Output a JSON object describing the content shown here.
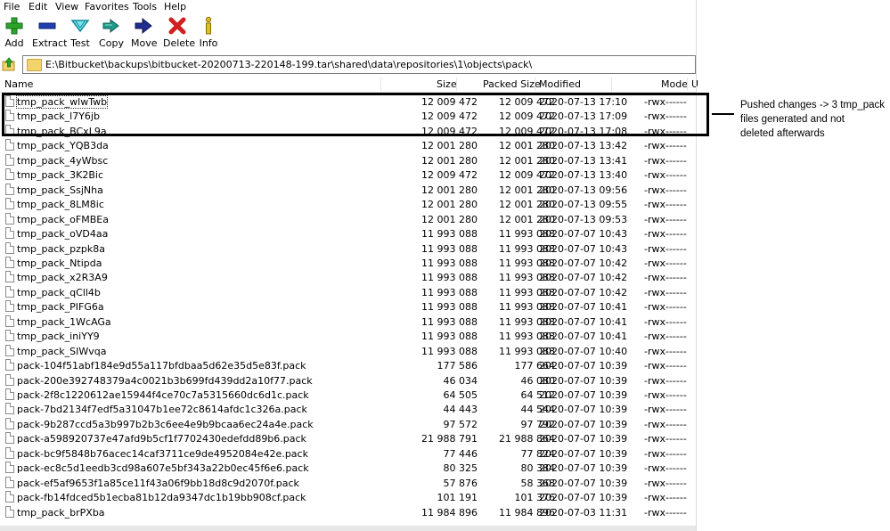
{
  "menu": [
    "File",
    "Edit",
    "View",
    "Favorites",
    "Tools",
    "Help"
  ],
  "toolbar": [
    {
      "label": "Add",
      "icon": "plus-icon",
      "color": "#2aa52a"
    },
    {
      "label": "Extract",
      "icon": "minus-icon",
      "color": "#1f3fb0"
    },
    {
      "label": "Test",
      "icon": "check-icon",
      "color": "#20b8c8"
    },
    {
      "label": "Copy",
      "icon": "double-arrow-icon",
      "color": "#1f9a8a"
    },
    {
      "label": "Move",
      "icon": "arrow-right-icon",
      "color": "#1f2f90"
    },
    {
      "label": "Delete",
      "icon": "cross-icon",
      "color": "#d02020"
    },
    {
      "label": "Info",
      "icon": "info-icon",
      "color": "#e0c020"
    }
  ],
  "address": {
    "path": "E:\\Bitbucket\\backups\\bitbucket-20200713-220148-199.tar\\shared\\data\\repositories\\1\\objects\\pack\\"
  },
  "columns": {
    "name": "Name",
    "size": "Size",
    "packed": "Packed Size",
    "modified": "Modified",
    "mode": "Mode",
    "user": "U"
  },
  "files": [
    {
      "name": "tmp_pack_wlwTwb",
      "size": "12 009 472",
      "packed": "12 009 472",
      "modified": "2020-07-13 17:10",
      "mode": "-rwx------"
    },
    {
      "name": "tmp_pack_l7Y6jb",
      "size": "12 009 472",
      "packed": "12 009 472",
      "modified": "2020-07-13 17:09",
      "mode": "-rwx------"
    },
    {
      "name": "tmp_pack_BCxL9a",
      "size": "12 009 472",
      "packed": "12 009 472",
      "modified": "2020-07-13 17:08",
      "mode": "-rwx------"
    },
    {
      "name": "tmp_pack_YQB3da",
      "size": "12 001 280",
      "packed": "12 001 280",
      "modified": "2020-07-13 13:42",
      "mode": "-rwx------"
    },
    {
      "name": "tmp_pack_4yWbsc",
      "size": "12 001 280",
      "packed": "12 001 280",
      "modified": "2020-07-13 13:41",
      "mode": "-rwx------"
    },
    {
      "name": "tmp_pack_3K2Bic",
      "size": "12 009 472",
      "packed": "12 009 472",
      "modified": "2020-07-13 13:40",
      "mode": "-rwx------"
    },
    {
      "name": "tmp_pack_SsjNha",
      "size": "12 001 280",
      "packed": "12 001 280",
      "modified": "2020-07-13 09:56",
      "mode": "-rwx------"
    },
    {
      "name": "tmp_pack_8LM8ic",
      "size": "12 001 280",
      "packed": "12 001 280",
      "modified": "2020-07-13 09:55",
      "mode": "-rwx------"
    },
    {
      "name": "tmp_pack_oFMBEa",
      "size": "12 001 280",
      "packed": "12 001 280",
      "modified": "2020-07-13 09:53",
      "mode": "-rwx------"
    },
    {
      "name": "tmp_pack_oVD4aa",
      "size": "11 993 088",
      "packed": "11 993 088",
      "modified": "2020-07-07 10:43",
      "mode": "-rwx------"
    },
    {
      "name": "tmp_pack_pzpk8a",
      "size": "11 993 088",
      "packed": "11 993 088",
      "modified": "2020-07-07 10:43",
      "mode": "-rwx------"
    },
    {
      "name": "tmp_pack_Ntipda",
      "size": "11 993 088",
      "packed": "11 993 088",
      "modified": "2020-07-07 10:42",
      "mode": "-rwx------"
    },
    {
      "name": "tmp_pack_x2R3A9",
      "size": "11 993 088",
      "packed": "11 993 088",
      "modified": "2020-07-07 10:42",
      "mode": "-rwx------"
    },
    {
      "name": "tmp_pack_qCll4b",
      "size": "11 993 088",
      "packed": "11 993 088",
      "modified": "2020-07-07 10:42",
      "mode": "-rwx------"
    },
    {
      "name": "tmp_pack_PIFG6a",
      "size": "11 993 088",
      "packed": "11 993 088",
      "modified": "2020-07-07 10:41",
      "mode": "-rwx------"
    },
    {
      "name": "tmp_pack_1WcAGa",
      "size": "11 993 088",
      "packed": "11 993 088",
      "modified": "2020-07-07 10:41",
      "mode": "-rwx------"
    },
    {
      "name": "tmp_pack_iniYY9",
      "size": "11 993 088",
      "packed": "11 993 088",
      "modified": "2020-07-07 10:41",
      "mode": "-rwx------"
    },
    {
      "name": "tmp_pack_SIWvqa",
      "size": "11 993 088",
      "packed": "11 993 088",
      "modified": "2020-07-07 10:40",
      "mode": "-rwx------"
    },
    {
      "name": "pack-104f51abf184e9d55a117bfdbaa5d62e35d5e83f.pack",
      "size": "177 586",
      "packed": "177 664",
      "modified": "2020-07-07 10:39",
      "mode": "-rwx------"
    },
    {
      "name": "pack-200e392748379a4c0021b3b699fd439dd2a10f77.pack",
      "size": "46 034",
      "packed": "46 080",
      "modified": "2020-07-07 10:39",
      "mode": "-rwx------"
    },
    {
      "name": "pack-2f8c1220612ae15944f4ce70c7a5315660dc6d1c.pack",
      "size": "64 505",
      "packed": "64 512",
      "modified": "2020-07-07 10:39",
      "mode": "-rwx------"
    },
    {
      "name": "pack-7bd2134f7edf5a31047b1ee72c8614afdc1c326a.pack",
      "size": "44 443",
      "packed": "44 544",
      "modified": "2020-07-07 10:39",
      "mode": "-rwx------"
    },
    {
      "name": "pack-9b287ccd5a3b997b2b3c6ee4e9b9bcaa6ec24a4e.pack",
      "size": "97 572",
      "packed": "97 792",
      "modified": "2020-07-07 10:39",
      "mode": "-rwx------"
    },
    {
      "name": "pack-a598920737e47afd9b5cf1f7702430edefdd89b6.pack",
      "size": "21 988 791",
      "packed": "21 988 864",
      "modified": "2020-07-07 10:39",
      "mode": "-rwx------"
    },
    {
      "name": "pack-bc9f5848b76acec14caf3711ce9de4952084e42e.pack",
      "size": "77 446",
      "packed": "77 824",
      "modified": "2020-07-07 10:39",
      "mode": "-rwx------"
    },
    {
      "name": "pack-ec8c5d1eedb3cd98a607e5bf343a22b0ec45f6e6.pack",
      "size": "80 325",
      "packed": "80 384",
      "modified": "2020-07-07 10:39",
      "mode": "-rwx------"
    },
    {
      "name": "pack-ef5af9653f1a85ce11f43a06f9bb18d8c9d2070f.pack",
      "size": "57 876",
      "packed": "58 368",
      "modified": "2020-07-07 10:39",
      "mode": "-rwx------"
    },
    {
      "name": "pack-fb14fdced5b1ecba81b12da9347dc1b19bb908cf.pack",
      "size": "101 191",
      "packed": "101 376",
      "modified": "2020-07-07 10:39",
      "mode": "-rwx------"
    },
    {
      "name": "tmp_pack_brPXba",
      "size": "11 984 896",
      "packed": "11 984 896",
      "modified": "2020-07-03 11:31",
      "mode": "-rwx------"
    }
  ],
  "annotation": {
    "text_lines": [
      "Pushed changes -> 3 tmp_pack",
      "files generated and not",
      "deleted afterwards"
    ]
  }
}
